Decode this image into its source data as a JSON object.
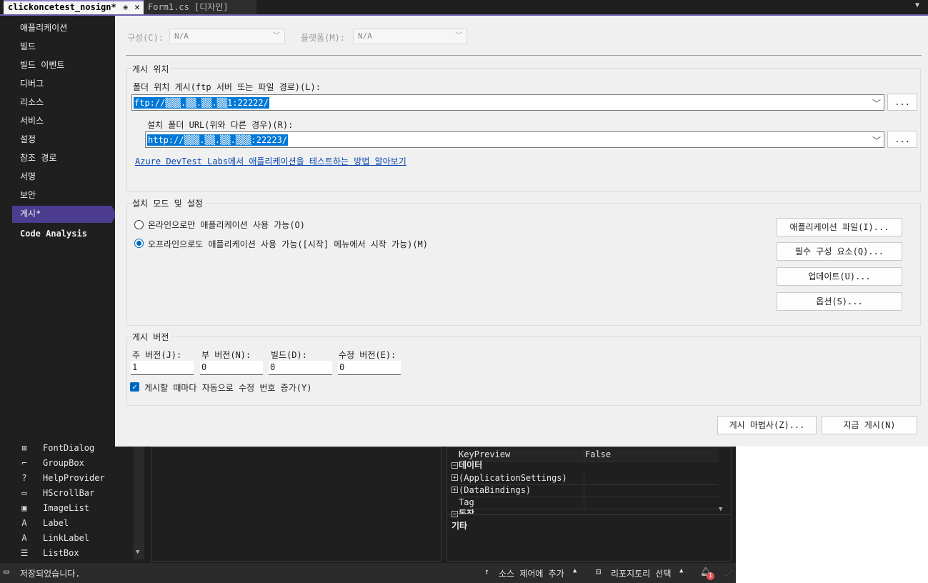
{
  "tabs": {
    "active": {
      "label": "clickoncetest_nosign*",
      "pin": "⊕",
      "close": "✕"
    },
    "inactive": {
      "label": "Form1.cs [디자인]"
    }
  },
  "nav": {
    "items": [
      {
        "label": "애플리케이션"
      },
      {
        "label": "빌드"
      },
      {
        "label": "빌드 이벤트"
      },
      {
        "label": "디버그"
      },
      {
        "label": "리소스"
      },
      {
        "label": "서비스"
      },
      {
        "label": "설정"
      },
      {
        "label": "참조 경로"
      },
      {
        "label": "서명"
      },
      {
        "label": "보안"
      },
      {
        "label": "게시*"
      },
      {
        "label": "Code Analysis"
      }
    ],
    "selected_index": 10
  },
  "config": {
    "config_label": "구성(C):",
    "config_value": "N/A",
    "platform_label": "플랫폼(M):",
    "platform_value": "N/A"
  },
  "publish_location": {
    "group_title": "게시 위치",
    "folder_label": "폴더 위치 게시(ftp 서버 또는 파일 경로)(L):",
    "folder_value": "ftp://▒▒▒.▒▒.▒▒.▒▒1:22222/",
    "browse1": "...",
    "install_label": "설치 폴더 URL(위와 다른 경우)(R):",
    "install_value": "http://▒▒▒.▒▒.▒▒.▒▒▒:22223/",
    "browse2": "...",
    "azure_link": "Azure DevTest Labs에서 애플리케이션을 테스트하는 방법 알아보기"
  },
  "install_mode": {
    "group_title": "설치 모드 및 설정",
    "online_only": "온라인으로만 애플리케이션 사용 가능(O)",
    "offline_too": "오프라인으로도 애플리케이션 사용 가능([시작] 메뉴에서 시작 가능)(M)",
    "selected": "offline_too",
    "btn_app_files": "애플리케이션 파일(I)...",
    "btn_prereq": "필수 구성 요소(Q)...",
    "btn_updates": "업데이트(U)...",
    "btn_options": "옵션(S)..."
  },
  "publish_version": {
    "group_title": "게시 버전",
    "major_label": "주 버전(J):",
    "minor_label": "부 버전(N):",
    "build_label": "빌드(D):",
    "revision_label": "수정 버전(E):",
    "major": "1",
    "minor": "0",
    "build": "0",
    "revision": "0",
    "auto_increment_label": "게시할 때마다 자동으로 수정 번호 증가(Y)",
    "auto_increment": true
  },
  "footer": {
    "wizard_button": "게시 마법사(Z)...",
    "publish_now_button": "지금 게시(N)"
  },
  "toolbox": {
    "items": [
      {
        "icon": "font-dialog-icon",
        "glyph": "⊞",
        "label": "FontDialog"
      },
      {
        "icon": "groupbox-icon",
        "glyph": "⌐",
        "label": "GroupBox"
      },
      {
        "icon": "help-provider-icon",
        "glyph": "?",
        "label": "HelpProvider"
      },
      {
        "icon": "hscrollbar-icon",
        "glyph": "▭",
        "label": "HScrollBar"
      },
      {
        "icon": "imagelist-icon",
        "glyph": "▣",
        "label": "ImageList"
      },
      {
        "icon": "label-icon",
        "glyph": "A",
        "label": "Label"
      },
      {
        "icon": "linklabel-icon",
        "glyph": "A",
        "label": "LinkLabel"
      },
      {
        "icon": "listbox-icon",
        "glyph": "☰",
        "label": "ListBox"
      }
    ]
  },
  "properties": {
    "rows": [
      {
        "name": "KeyPreview",
        "value": "False"
      },
      {
        "name": "데이터",
        "value": "",
        "category": true
      },
      {
        "name": "(ApplicationSettings)",
        "value": "",
        "expandable": true
      },
      {
        "name": "(DataBindings)",
        "value": "",
        "expandable": true
      },
      {
        "name": "Tag",
        "value": ""
      },
      {
        "name": "동작",
        "value": "",
        "category": true
      }
    ],
    "description": "기타"
  },
  "statusbar": {
    "message": "저장되었습니다.",
    "source_control": "소스 제어에 추가",
    "repository": "리포지토리 선택",
    "notification_count": "1"
  }
}
